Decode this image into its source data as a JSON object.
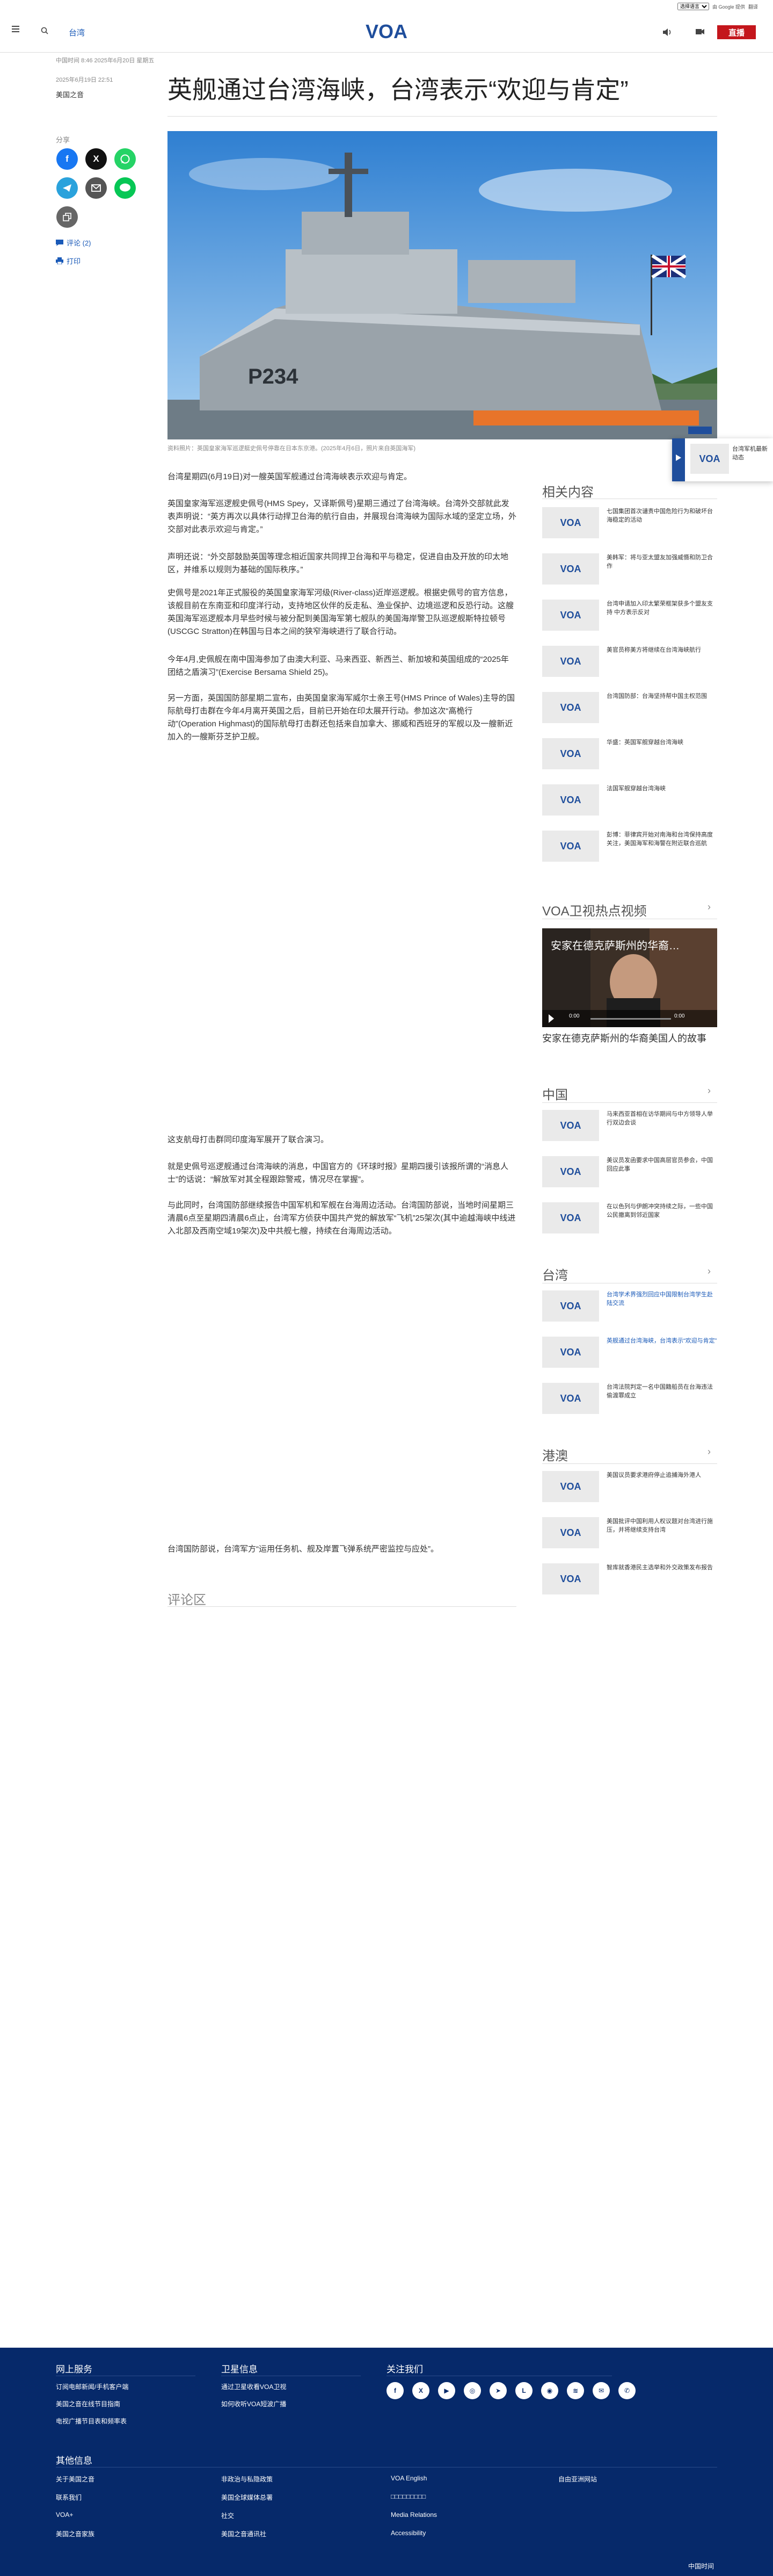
{
  "translate_bar": {
    "select_value": "选择语言",
    "label": "由 Google 提供",
    "translate": "翻译"
  },
  "header": {
    "section_link": "台湾",
    "logo_text": "VOA",
    "live_label": "直播"
  },
  "article": {
    "dateline": "中国时间 8:46 2025年6月20日 星期五",
    "published": "2025年6月19日 22:51",
    "section": "美国之音",
    "title": "英舰通过台湾海峡，台湾表示“欢迎与肯定”",
    "share_label": "分享",
    "comments_link": "评论 (2)",
    "print_link": "打印",
    "image_caption": "资料照片：英国皇家海军巡逻艇史佩号停靠在日本东京港。(2025年4月6日，照片来自英国海军)",
    "paragraphs": [
      "台湾星期四(6月19日)对一艘英国军舰通过台湾海峡表示欢迎与肯定。",
      "英国皇家海军巡逻舰史佩号(HMS Spey，又译斯佩号)星期三通过了台湾海峡。台湾外交部就此发表声明说：“英方再次以具体行动捍卫台海的航行自由，并展现台湾海峡为国际水域的坚定立场，外交部对此表示欢迎与肯定。”",
      "声明还说：“外交部鼓励英国等理念相近国家共同捍卫台海和平与稳定，促进自由及开放的印太地区，并维系以规则为基础的国际秩序。”",
      "史佩号是2021年正式服役的英国皇家海军河级(River-class)近岸巡逻舰。根据史佩号的官方信息，该舰目前在东南亚和印度洋行动，支持地区伙伴的反走私、渔业保护、边境巡逻和反恐行动。这艘英国海军巡逻舰本月早些时候与被分配到美国海军第七舰队的美国海岸警卫队巡逻舰斯特拉顿号(USCGC Stratton)在韩国与日本之间的狭窄海峡进行了联合行动。",
      "今年4月,史佩舰在南中国海参加了由澳大利亚、马来西亚、新西兰、新加坡和英国组成的“2025年团结之盾演习”(Exercise Bersama Shield 25)。",
      "另一方面，英国国防部星期二宣布，由英国皇家海军威尔士亲王号(HMS Prince of Wales)主导的国际航母打击群在今年4月离开英国之后，目前已开始在印太展开行动。参加这次“高桅行动”(Operation Highmast)的国际航母打击群还包括来自加拿大、挪威和西班牙的军舰以及一艘新近加入的一艘斯芬芝护卫舰。",
      "这支航母打击群同印度海军展开了联合演习。",
      "就是史佩号巡逻舰通过台湾海峡的消息，中国官方的《环球时报》星期四援引该报所谓的“消息人士”的话说：“解放军对其全程跟踪警戒，情况尽在掌握”。",
      "与此同时，台湾国防部继续报告中国军机和军舰在台海周边活动。台湾国防部说，当地时间星期三清晨6点至星期四清晨6点止，台湾军方侦获中国共产党的解放军“飞机”25架次(其中逾越海峡中线进入北部及西南空域19架次)及中共舰七艘，持续在台海周边活动。",
      "台湾国防部说，台湾军方“运用任务机、舰及岸置飞弹系统严密监控与应处”。"
    ],
    "comments_heading": "评论区"
  },
  "sidebar": {
    "related_heading": "相关内容",
    "related": [
      "七国集团首次谴责中国危险行为和破坏台海稳定的活动",
      "美韩军：将与亚太盟友加强威慑和防卫合作",
      "台湾申请加入印太繁荣框架获多个盟友支持 中方表示反对",
      "美官员称美方将继续在台湾海峡航行",
      "台湾国防部：台海坚持帮中国主权范围",
      "华盛：英国军舰穿越台湾海峡",
      "法国军舰穿越台湾海峡",
      "彭博：菲律宾开始对南海和台湾保持高度关注，美国海军和海警在附近联合巡航"
    ],
    "video_heading": "VOA卫视热点视频",
    "video_overlay": "安家在德克萨斯州的华裔…",
    "video_time_current": "0:00",
    "video_time_total": "0:00",
    "video_caption": "安家在德克萨斯州的华裔美国人的故事",
    "china_heading": "中国",
    "china_items": [
      "马来西亚首相在访华期间与中方领导人举行双边会谈",
      "美议员发函要求中国高层官员参会，中国回应此事",
      "在以色列与伊朗冲突持续之际，一些中国公民撤离到邻近国家"
    ],
    "taiwan_heading": "台湾",
    "taiwan_items": [
      "台湾学术界强烈回应中国限制台湾学生赴陆交流",
      "英舰通过台湾海峡，台湾表示“欢迎与肯定”",
      "台湾法院判定一名中国籍船员在台海违法偷渡罪成立"
    ],
    "hk_heading": "港澳",
    "hk_items": [
      "美国议员要求港府停止追捕海外港人",
      "美国批评中国利用人权议题对台湾进行施压，并将继续支持台湾",
      "智库就香港民主选举和外交政策发布报告"
    ],
    "promo_text": "台湾军机最新动态"
  },
  "footer": {
    "online_heading": "网上服务",
    "online_links": [
      "订阅电邮新闻/手机客户端",
      "美国之音在线节目指南",
      "电视广播节目表和频率表"
    ],
    "sat_heading": "卫星信息",
    "sat_links": [
      "通过卫星收看VOA卫视",
      "如何收听VOA短波广播"
    ],
    "follow_heading": "关注我们",
    "social": [
      "facebook-icon",
      "x-icon",
      "youtube-icon",
      "instagram-icon",
      "telegram-icon",
      "line-icon",
      "podcast-icon",
      "rss-icon",
      "email-icon",
      "sms-icon"
    ],
    "other_heading": "其他信息",
    "other_col1": [
      "关于美国之音",
      "联系我们",
      "VOA+",
      "美国之音家族"
    ],
    "other_col2": [
      "非政治与私隐政策",
      "美国全球媒体总署",
      "社交",
      "美国之音通讯社"
    ],
    "other_col3": [
      "VOA English",
      "□□□□□□□□□",
      "Media Relations",
      "Accessibility"
    ],
    "other_col4": [
      "自由亚洲网站"
    ],
    "bottom_text": "中国时间"
  }
}
